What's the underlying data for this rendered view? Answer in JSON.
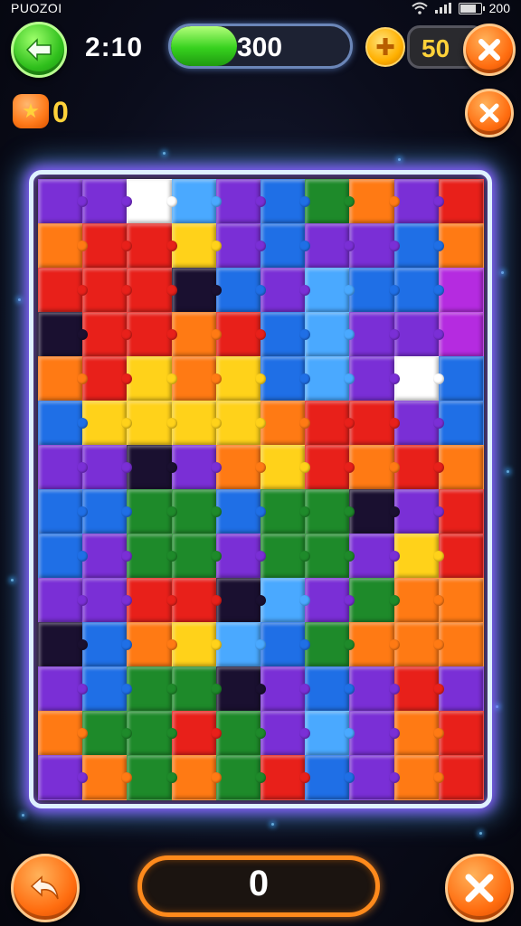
{
  "status_bar": {
    "left_text": "PUOZOI",
    "right_text": "200",
    "wifi_icon": "wifi-icon",
    "signal_icon": "signal-icon",
    "battery_icon": "battery-icon"
  },
  "hud": {
    "back_icon": "arrow-left-icon",
    "timer": "2:10",
    "progress_fraction": 0.37,
    "score": "300",
    "coin_icon": "coin-plus-icon",
    "coins": "50",
    "close_icon": "close-icon"
  },
  "sub_hud": {
    "star_icon": "star-badge-icon",
    "stars": "0",
    "close_icon": "close-icon"
  },
  "board": {
    "columns": 10,
    "rows": 14,
    "palette": {
      "purple": "#7a2fd6",
      "blue": "#1f6fe6",
      "lightblue": "#4aa9ff",
      "red": "#e8201a",
      "orange": "#ff7a14",
      "yellow": "#ffd21a",
      "green": "#1e8a2a",
      "white": "#ffffff",
      "dark": "#1a1030",
      "magenta": "#b52be0"
    },
    "pieces": [
      [
        "purple",
        "purple",
        "white",
        "lightblue",
        "purple",
        "blue",
        "green",
        "orange",
        "purple",
        "red"
      ],
      [
        "orange",
        "red",
        "red",
        "yellow",
        "purple",
        "blue",
        "purple",
        "purple",
        "blue",
        "orange"
      ],
      [
        "red",
        "red",
        "red",
        "dark",
        "blue",
        "purple",
        "lightblue",
        "blue",
        "blue",
        "magenta"
      ],
      [
        "dark",
        "red",
        "red",
        "orange",
        "red",
        "blue",
        "lightblue",
        "purple",
        "purple",
        "magenta"
      ],
      [
        "orange",
        "red",
        "yellow",
        "orange",
        "yellow",
        "blue",
        "lightblue",
        "purple",
        "white",
        "blue"
      ],
      [
        "blue",
        "yellow",
        "yellow",
        "yellow",
        "yellow",
        "orange",
        "red",
        "red",
        "purple",
        "blue"
      ],
      [
        "purple",
        "purple",
        "dark",
        "purple",
        "orange",
        "yellow",
        "red",
        "orange",
        "red",
        "orange"
      ],
      [
        "blue",
        "blue",
        "green",
        "green",
        "blue",
        "green",
        "green",
        "dark",
        "purple",
        "red"
      ],
      [
        "blue",
        "purple",
        "green",
        "green",
        "purple",
        "green",
        "green",
        "purple",
        "yellow",
        "red"
      ],
      [
        "purple",
        "purple",
        "red",
        "red",
        "dark",
        "lightblue",
        "purple",
        "green",
        "orange",
        "orange"
      ],
      [
        "dark",
        "blue",
        "orange",
        "yellow",
        "lightblue",
        "blue",
        "green",
        "orange",
        "orange",
        "orange"
      ],
      [
        "purple",
        "blue",
        "green",
        "green",
        "dark",
        "purple",
        "blue",
        "purple",
        "red",
        "purple"
      ],
      [
        "orange",
        "green",
        "green",
        "red",
        "green",
        "purple",
        "lightblue",
        "purple",
        "orange",
        "red"
      ],
      [
        "purple",
        "orange",
        "green",
        "orange",
        "green",
        "red",
        "blue",
        "purple",
        "orange",
        "red"
      ]
    ]
  },
  "footer": {
    "undo_icon": "undo-arrow-icon",
    "value": "0",
    "close_icon": "close-icon"
  }
}
